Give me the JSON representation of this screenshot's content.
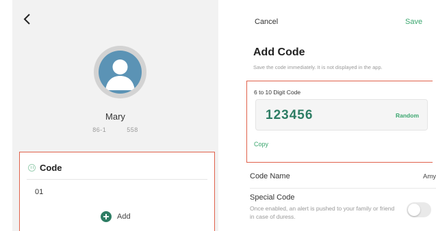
{
  "left": {
    "contact_name": "Mary",
    "contact_phone": "86-1          558",
    "code_section_title": "Code",
    "code_value": "01",
    "add_label": "Add"
  },
  "right": {
    "cancel_label": "Cancel",
    "save_label": "Save",
    "title": "Add Code",
    "subtitle": "Save the code immediately. It is not displayed in the app.",
    "digit_label": "6 to 10 Digit Code",
    "code": "123456",
    "random_label": "Random",
    "copy_label": "Copy",
    "code_name_label": "Code Name",
    "code_name_value": "Amy",
    "special_code_label": "Special Code",
    "special_code_desc": "Once enabled, an alert is pushed to your family or friend in case of duress.",
    "special_code_enabled": false
  },
  "colors": {
    "accent": "#3aa66e",
    "accent_dark": "#2e7d64",
    "highlight_border": "#e0604a",
    "avatar_blue": "#5b93b5"
  },
  "icons": {
    "back": "chevron-left-icon",
    "code": "code-icon",
    "add": "plus-circle-icon"
  }
}
